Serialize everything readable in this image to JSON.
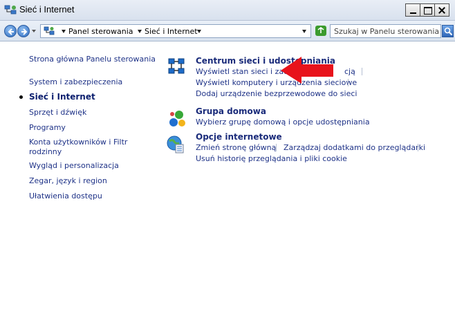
{
  "window": {
    "title": "Sieć i Internet"
  },
  "address": {
    "crumbs": [
      "Panel sterowania",
      "Sieć i Internet"
    ]
  },
  "search": {
    "placeholder": "Szukaj w Panelu sterowania"
  },
  "sidebar": {
    "items": [
      {
        "label": "Strona główna Panelu sterowania"
      },
      {
        "label": "System i zabezpieczenia"
      },
      {
        "label": "Sieć i Internet"
      },
      {
        "label": "Sprzęt i dźwięk"
      },
      {
        "label": "Programy"
      },
      {
        "label": "Konta użytkowników i Filtr rodzinny"
      },
      {
        "label": "Wygląd i personalizacja"
      },
      {
        "label": "Zegar, język i region"
      },
      {
        "label": "Ułatwienia dostępu"
      }
    ]
  },
  "main": {
    "groups": [
      {
        "title": "Centrum sieci i udostępniania",
        "tasks": [
          "Wyświetl stan sieci i zadania",
          "cją",
          "Wyświetl komputery i urządzenia sieciowe",
          "Dodaj urządzenie bezprzewodowe do sieci"
        ]
      },
      {
        "title": "Grupa domowa",
        "tasks": [
          "Wybierz grupę domową i opcje udostępniania"
        ]
      },
      {
        "title": "Opcje internetowe",
        "tasks": [
          "Zmień stronę główną",
          "Zarządzaj dodatkami do przeglądarki",
          "Usuń historię przeglądania i pliki cookie"
        ]
      }
    ]
  },
  "colors": {
    "link": "#1e3287",
    "accent_arrow": "#e8131b"
  }
}
